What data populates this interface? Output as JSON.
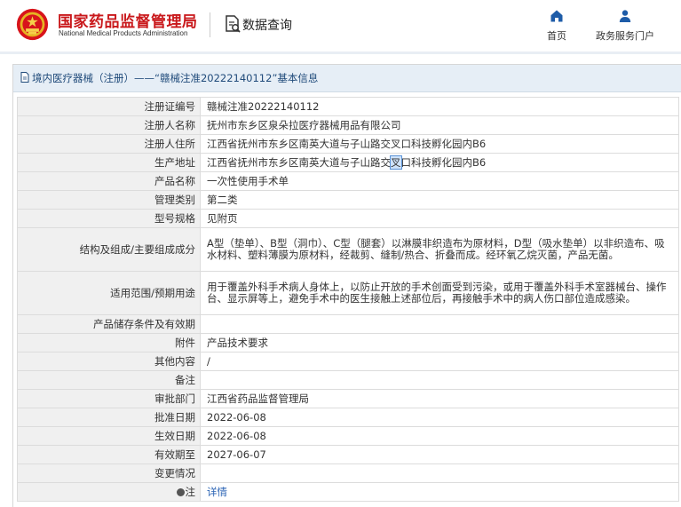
{
  "header": {
    "brand_cn": "国家药品监督管理局",
    "brand_en": "National Medical Products Administration",
    "section_title": "数据查询",
    "nav": [
      {
        "label": "首页",
        "icon": "home-icon"
      },
      {
        "label": "政务服务门户",
        "icon": "user-icon"
      }
    ],
    "brand_color": "#c9181b"
  },
  "breadcrumb": {
    "text": "境内医疗器械（注册）——“赣械注准20222140112”基本信息"
  },
  "record": {
    "rows": [
      {
        "label": "注册证编号",
        "value": "赣械注准20222140112"
      },
      {
        "label": "注册人名称",
        "value": "抚州市东乡区泉朵拉医疗器械用品有限公司"
      },
      {
        "label": "注册人住所",
        "value": "江西省抚州市东乡区南英大道与子山路交叉口科技孵化园内B6"
      },
      {
        "label": "生产地址",
        "value_before": "江西省抚州市东乡区南英大道与子山路交",
        "value_highlight": "叉",
        "value_after": "口科技孵化园内B6"
      },
      {
        "label": "产品名称",
        "value": "一次性使用手术单"
      },
      {
        "label": "管理类别",
        "value": "第二类"
      },
      {
        "label": "型号规格",
        "value": "见附页"
      },
      {
        "label": "结构及组成/主要组成成分",
        "value": "A型（垫单）、B型（洞巾）、C型（腿套）以淋膜非织造布为原材料，D型（吸水垫单）以非织造布、吸水材料、塑料薄膜为原材料，经裁剪、缝制/热合、折叠而成。经环氧乙烷灭菌，产品无菌。"
      },
      {
        "label": "适用范围/预期用途",
        "value": "用于覆盖外科手术病人身体上，以防止开放的手术创面受到污染，或用于覆盖外科手术室器械台、操作台、显示屏等上，避免手术中的医生接触上述部位后，再接触手术中的病人伤口部位造成感染。"
      },
      {
        "label": "产品储存条件及有效期",
        "value": ""
      },
      {
        "label": "附件",
        "value": "产品技术要求"
      },
      {
        "label": "其他内容",
        "value": "/"
      },
      {
        "label": "备注",
        "value": ""
      },
      {
        "label": "审批部门",
        "value": "江西省药品监督管理局"
      },
      {
        "label": "批准日期",
        "value": "2022-06-08"
      },
      {
        "label": "生效日期",
        "value": "2022-06-08"
      },
      {
        "label": "有效期至",
        "value": "2027-06-07"
      },
      {
        "label": "变更情况",
        "value": ""
      },
      {
        "label": "注",
        "value": "详情",
        "is_link": true
      }
    ]
  }
}
